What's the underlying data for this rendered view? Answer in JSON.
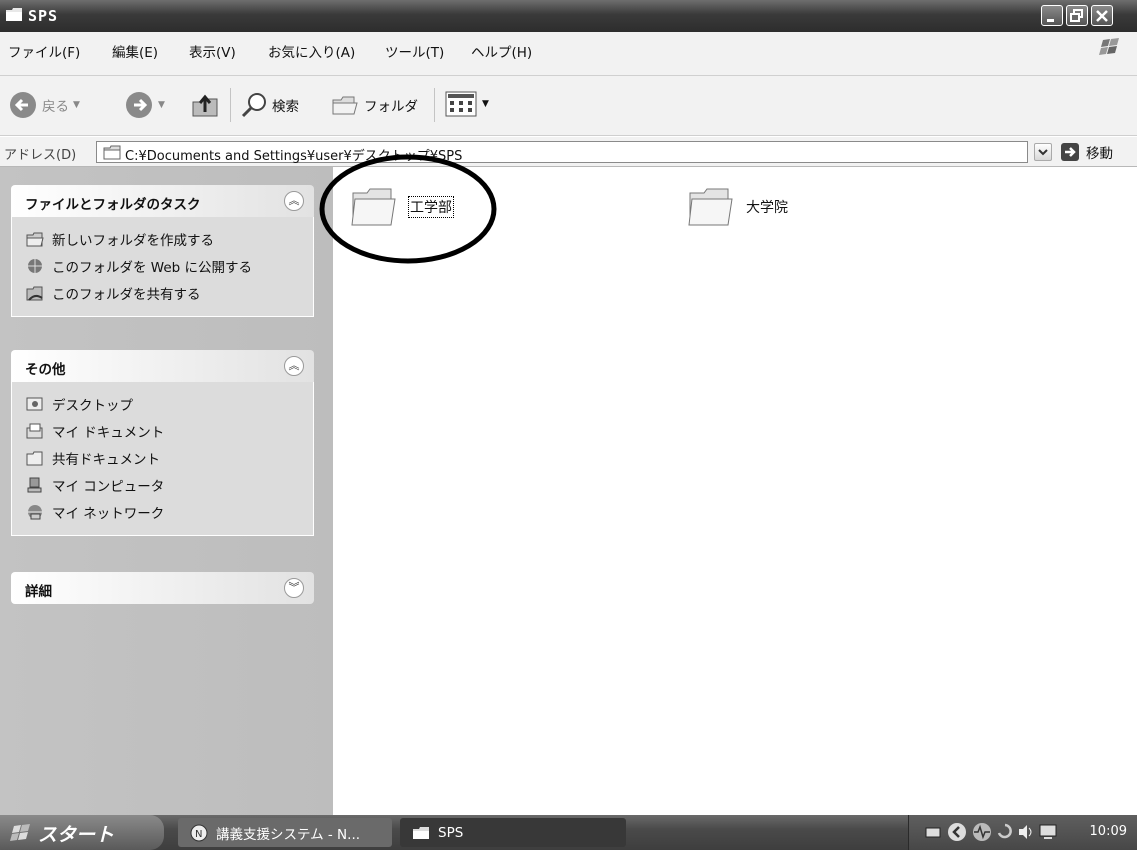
{
  "window": {
    "title": "SPS"
  },
  "menu": {
    "items": [
      "ファイル(F)",
      "編集(E)",
      "表示(V)",
      "お気に入り(A)",
      "ツール(T)",
      "ヘルプ(H)"
    ]
  },
  "toolbar": {
    "back_label": "戻る",
    "search_label": "検索",
    "folders_label": "フォルダ"
  },
  "address": {
    "label": "アドレス(D)",
    "value": "C:¥Documents and Settings¥user¥デスクトップ¥SPS",
    "go_label": "移動"
  },
  "tasks": {
    "file_folder": {
      "title": "ファイルとフォルダのタスク",
      "items": [
        "新しいフォルダを作成する",
        "このフォルダを Web に公開する",
        "このフォルダを共有する"
      ]
    },
    "other": {
      "title": "その他",
      "items": [
        "デスクトップ",
        "マイ ドキュメント",
        "共有ドキュメント",
        "マイ コンピュータ",
        "マイ ネットワーク"
      ]
    },
    "details": {
      "title": "詳細"
    }
  },
  "folders": [
    {
      "name": "工学部"
    },
    {
      "name": "大学院"
    }
  ],
  "taskbar": {
    "start_label": "スタート",
    "tasks": [
      "講義支援システム - N...",
      "SPS"
    ],
    "clock": "10:09"
  }
}
